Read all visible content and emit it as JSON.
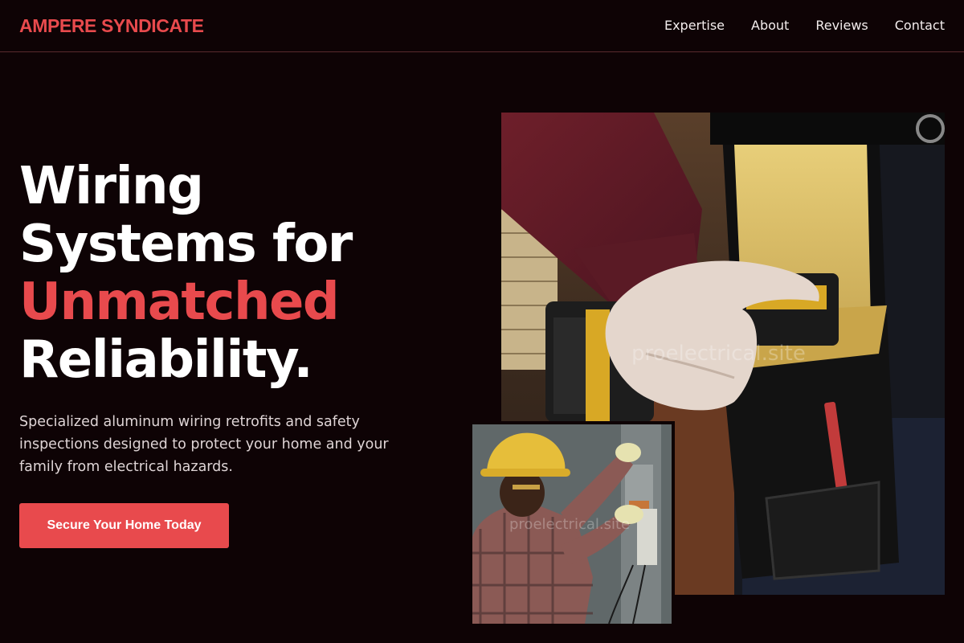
{
  "brand": {
    "name": "AMPERE SYNDICATE",
    "accent_color": "#e84a4d"
  },
  "nav": {
    "items": [
      {
        "label": "Expertise"
      },
      {
        "label": "About"
      },
      {
        "label": "Reviews"
      },
      {
        "label": "Contact"
      }
    ]
  },
  "hero": {
    "title_line1": "Wiring",
    "title_line2": "Systems for",
    "title_accent": "Unmatched",
    "title_line4": "Reliability.",
    "subtitle": "Specialized aluminum wiring retrofits and safety inspections designed to protect your home and your family from electrical hazards.",
    "cta_label": "Secure Your Home Today"
  },
  "images": {
    "main_watermark": "proelectrical.site",
    "small_watermark": "proelectrical.site"
  },
  "colors": {
    "background": "#0e0305",
    "accent": "#e84a4d",
    "divider": "#5a2a2e",
    "body_text": "#dfd5d6"
  }
}
